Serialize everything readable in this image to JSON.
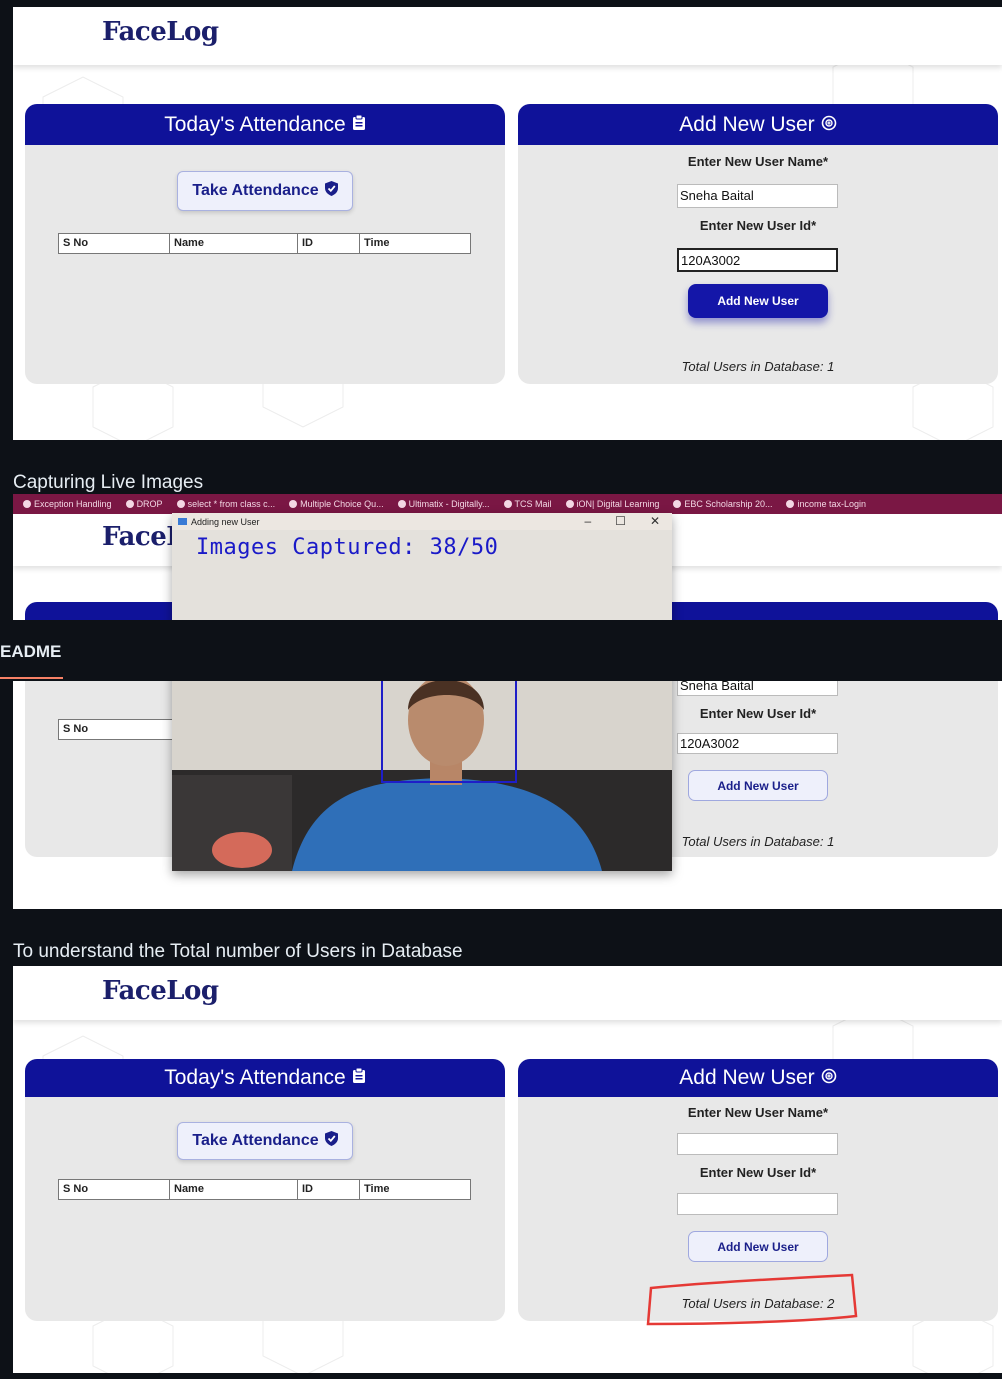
{
  "logo": "FaceLog",
  "captions": {
    "capturing": "Capturing Live Images",
    "total_users": "To understand the Total number of Users in Database"
  },
  "readme_tab": "EADME",
  "attendance": {
    "title": "Today's Attendance",
    "take_button": "Take Attendance",
    "columns": [
      "S No",
      "Name",
      "ID",
      "Time"
    ]
  },
  "add_user": {
    "title": "Add New User",
    "name_label": "Enter New User Name*",
    "id_label": "Enter New User Id*",
    "button": "Add New User"
  },
  "shots": [
    {
      "name_value": "Sneha Baital",
      "id_value": "120A3002",
      "total": "Total Users in Database: 1"
    },
    {
      "name_value": "Sneha Baital",
      "id_value": "120A3002",
      "total": "Total Users in Database: 1"
    },
    {
      "name_value": "",
      "id_value": "",
      "total": "Total Users in Database: 2"
    }
  ],
  "camera_window": {
    "title": "Adding new User",
    "overlay_text": "Images Captured: 38/50"
  },
  "bookmarks": [
    "Exception Handling",
    "DROP",
    "select * from class c...",
    "Multiple Choice Qu...",
    "Ultimatix - Digitally...",
    "TCS Mail",
    "iON| Digital Learning",
    "EBC Scholarship 20...",
    "income tax-Login"
  ],
  "colors": {
    "brand_blue": "#0f1299",
    "highlight_red": "#e53935"
  }
}
